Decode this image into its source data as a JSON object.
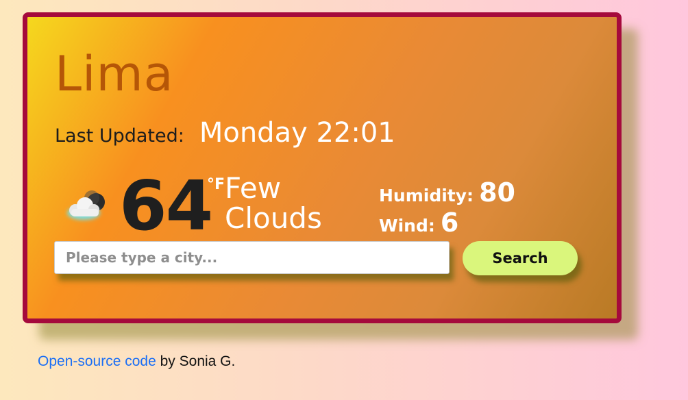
{
  "weather": {
    "city": "Lima",
    "last_updated_label": "Last Updated:",
    "last_updated_value": "Monday 22:01",
    "temperature": "64",
    "unit": "°F",
    "description": "Few Clouds",
    "icon": "few-clouds-night-icon",
    "humidity_label": "Humidity:",
    "humidity_value": "80",
    "wind_label": "Wind:",
    "wind_value": "6"
  },
  "search": {
    "placeholder": "Please type a city...",
    "button_label": "Search"
  },
  "footer": {
    "link_text": "Open-source code",
    "author_text": " by Sonia G."
  },
  "colors": {
    "border": "#a50a3c",
    "city_text": "#b55607",
    "search_button": "#daf67c",
    "link": "#1a6ef5"
  }
}
